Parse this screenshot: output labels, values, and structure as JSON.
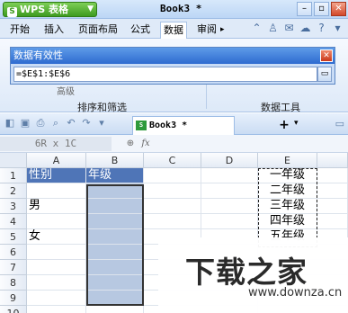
{
  "titlebar": {
    "app_name": "WPS 表格",
    "doc_title": "Book3 *"
  },
  "ribbon_tabs": [
    "开始",
    "插入",
    "页面布局",
    "公式",
    "数据",
    "审阅"
  ],
  "ribbon": {
    "group1_label": "排序和筛选",
    "group2_label": "数据工具",
    "hidden_item": "高级"
  },
  "dialog": {
    "title": "数据有效性",
    "input_value": "=$E$1:$E$6"
  },
  "doc_tab": {
    "label": "Book3 *"
  },
  "formula_bar": {
    "name_box": "6R x 1C",
    "fx": "fx"
  },
  "grid": {
    "columns": [
      "A",
      "B",
      "C",
      "D",
      "E"
    ],
    "rows": [
      "1",
      "2",
      "3",
      "4",
      "5",
      "6",
      "7",
      "8",
      "9",
      "10"
    ],
    "A": [
      "性别",
      "",
      "男",
      "",
      "女",
      "",
      "",
      "",
      "",
      ""
    ],
    "B": [
      "年级",
      "",
      "",
      "",
      "",
      "",
      "",
      "",
      "",
      ""
    ],
    "E": [
      "一年级",
      "二年级",
      "三年级",
      "四年级",
      "五年级",
      "",
      "",
      "",
      "",
      ""
    ]
  },
  "watermark": {
    "logo": "下载之家",
    "url": "www.downza.cn"
  }
}
